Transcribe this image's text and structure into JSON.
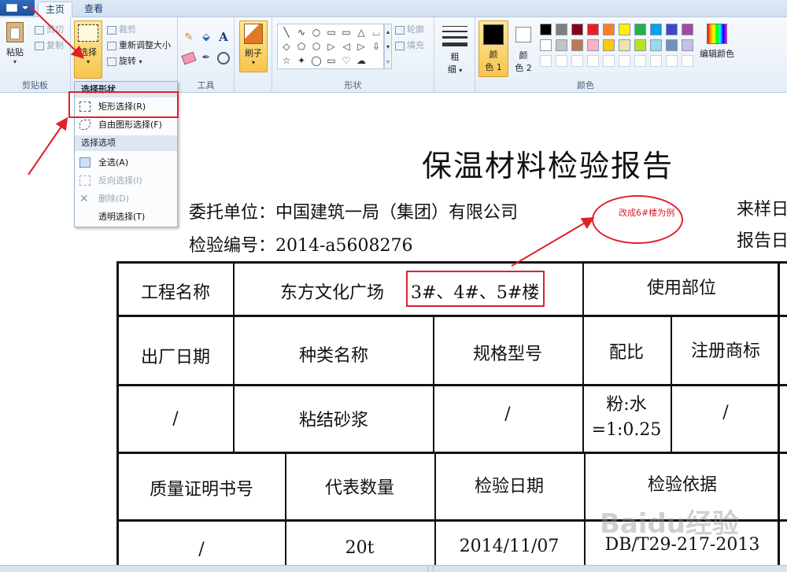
{
  "tabs": {
    "home": "主页",
    "view": "查看"
  },
  "clipboard": {
    "paste": "粘贴",
    "cut": "剪切",
    "copy": "复制",
    "group": "剪贴板"
  },
  "image": {
    "select": "选择",
    "crop": "裁剪",
    "resize": "重新调整大小",
    "rotate": "旋转"
  },
  "tools": {
    "group": "工具"
  },
  "brush": {
    "label": "刷子"
  },
  "shapes": {
    "group": "形状",
    "outline": "轮廓",
    "fill": "填充",
    "glyphs": [
      "╲",
      "∿",
      "○",
      "▭",
      "▭",
      "△",
      "⌴",
      "◇",
      "⬠",
      "⬡",
      "▷",
      "◁",
      "▷",
      "⇩",
      "☆",
      "✦",
      "◯",
      "▭",
      "♡",
      "☁"
    ]
  },
  "size": {
    "label1": "粗",
    "label2": "细"
  },
  "colors": {
    "group": "颜色",
    "color1": "颜",
    "color1b": "色 1",
    "color2": "颜",
    "color2b": "色 2",
    "edit": "编辑颜色",
    "row1": [
      "#000000",
      "#7f7f7f",
      "#880015",
      "#ed1c24",
      "#ff7f27",
      "#fff200",
      "#22b14c",
      "#00a2e8",
      "#3f48cc",
      "#a349a4"
    ],
    "row2": [
      "#ffffff",
      "#c3c3c3",
      "#b97a57",
      "#ffaec9",
      "#ffc90e",
      "#efe4b0",
      "#b5e61d",
      "#99d9ea",
      "#7092be",
      "#c8bfe7"
    ]
  },
  "dropdown": {
    "shape_head": "选择形状",
    "rect": "矩形选择(R)",
    "free": "自由图形选择(F)",
    "opt_head": "选择选项",
    "all": "全选(A)",
    "invert": "反向选择(I)",
    "delete": "删除(D)",
    "transparent": "透明选择(T)"
  },
  "doc": {
    "title": "保温材料检验报告",
    "client": "委托单位：中国建筑一局（集团）有限公司",
    "number": "检验编号：2014-a5608276",
    "sample_date": "来样日",
    "report_date": "报告日",
    "annotation": "改成6#楼为例",
    "watermark": "Baidu经验"
  },
  "table": {
    "r1": {
      "c1": "工程名称",
      "c2": "东方文化广场",
      "c2b": "3#、4#、5#楼",
      "c3": "使用部位"
    },
    "r2": {
      "c1": "出厂日期",
      "c2": "种类名称",
      "c3": "规格型号",
      "c4": "配比",
      "c5": "注册商标"
    },
    "r3": {
      "c1": "/",
      "c2": "粘结砂浆",
      "c3": "/",
      "c4a": "粉:水",
      "c4b": "=1:0.25",
      "c5": "/"
    },
    "r4": {
      "c1": "质量证明书号",
      "c2": "代表数量",
      "c3": "检验日期",
      "c4": "检验依据"
    },
    "r5": {
      "c1": "/",
      "c2": "20t",
      "c3": "2014/11/07",
      "c4": "DB/T29-217-2013"
    }
  }
}
